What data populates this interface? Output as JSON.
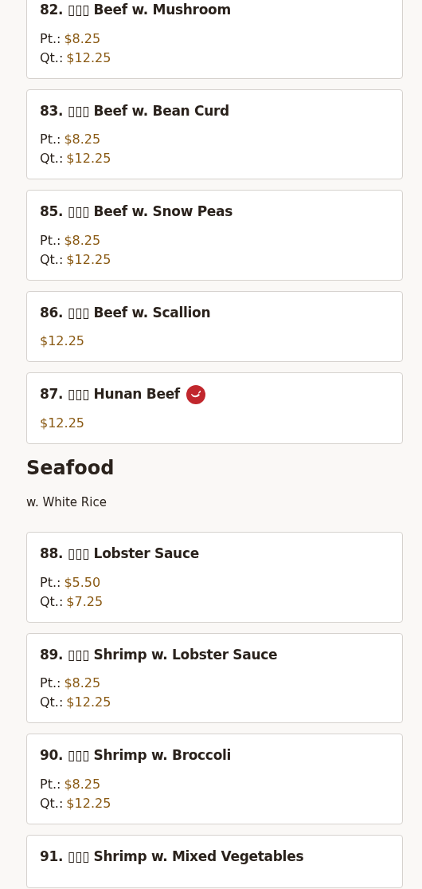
{
  "sections": [
    {
      "items": [
        {
          "name": "82. ▯▯▯ Beef w. Mushroom",
          "spicy": false,
          "prices": [
            {
              "label": "Pt.:",
              "amount": "$8.25"
            },
            {
              "label": "Qt.:",
              "amount": "$12.25"
            }
          ]
        },
        {
          "name": "83. ▯▯▯ Beef w. Bean Curd",
          "spicy": false,
          "prices": [
            {
              "label": "Pt.:",
              "amount": "$8.25"
            },
            {
              "label": "Qt.:",
              "amount": "$12.25"
            }
          ]
        },
        {
          "name": "85. ▯▯▯ Beef w. Snow Peas",
          "spicy": false,
          "prices": [
            {
              "label": "Pt.:",
              "amount": "$8.25"
            },
            {
              "label": "Qt.:",
              "amount": "$12.25"
            }
          ]
        },
        {
          "name": "86. ▯▯▯ Beef w. Scallion",
          "spicy": false,
          "prices": [
            {
              "amount": "$12.25"
            }
          ]
        },
        {
          "name": "87. ▯▯▯ Hunan Beef",
          "spicy": true,
          "prices": [
            {
              "amount": "$12.25"
            }
          ]
        }
      ]
    },
    {
      "title": "Seafood",
      "subtitle": "w. White Rice",
      "items": [
        {
          "name": "88. ▯▯▯ Lobster Sauce",
          "spicy": false,
          "prices": [
            {
              "label": "Pt.:",
              "amount": "$5.50"
            },
            {
              "label": "Qt.:",
              "amount": "$7.25"
            }
          ]
        },
        {
          "name": "89. ▯▯▯ Shrimp w. Lobster Sauce",
          "spicy": false,
          "prices": [
            {
              "label": "Pt.:",
              "amount": "$8.25"
            },
            {
              "label": "Qt.:",
              "amount": "$12.25"
            }
          ]
        },
        {
          "name": "90. ▯▯▯ Shrimp w. Broccoli",
          "spicy": false,
          "prices": [
            {
              "label": "Pt.:",
              "amount": "$8.25"
            },
            {
              "label": "Qt.:",
              "amount": "$12.25"
            }
          ]
        },
        {
          "name": "91. ▯▯▯ Shrimp w. Mixed Vegetables",
          "spicy": false
        }
      ]
    }
  ]
}
